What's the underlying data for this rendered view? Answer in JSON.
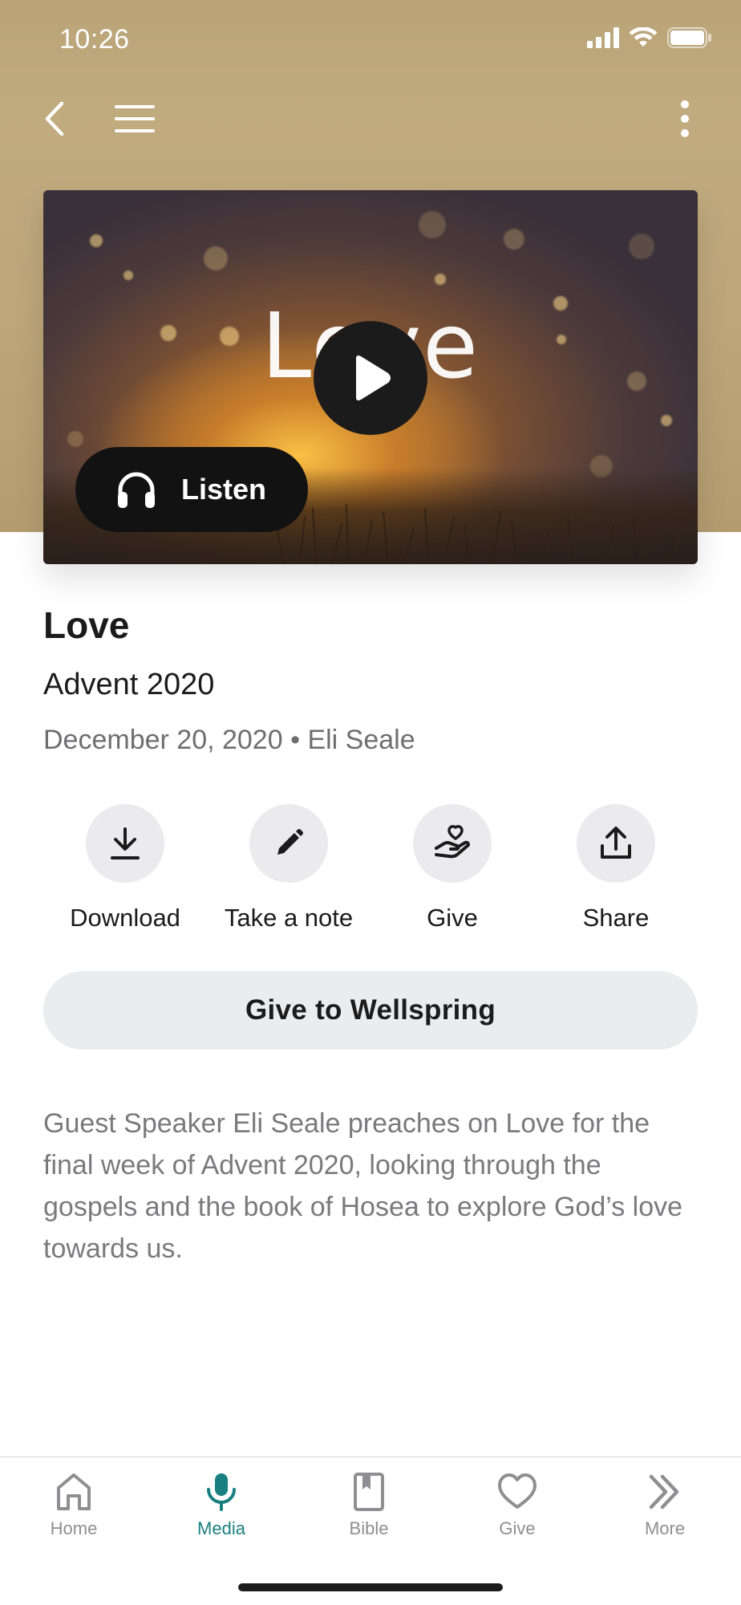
{
  "status_bar": {
    "time": "10:26"
  },
  "nav": {
    "back_icon": "chevron-left-icon",
    "menu_icon": "hamburger-icon",
    "more_icon": "vertical-dots-icon"
  },
  "media": {
    "card_title": "Love",
    "play_icon": "play-icon",
    "listen_label": "Listen",
    "listen_icon": "headphones-icon"
  },
  "sermon": {
    "title": "Love",
    "series": "Advent 2020",
    "date": "December 20, 2020",
    "separator": "•",
    "speaker": "Eli Seale"
  },
  "actions": [
    {
      "label": "Download",
      "icon": "download-icon"
    },
    {
      "label": "Take a note",
      "icon": "pencil-icon"
    },
    {
      "label": "Give",
      "icon": "heart-hand-icon"
    },
    {
      "label": "Share",
      "icon": "share-icon"
    }
  ],
  "give_cta": "Give to Wellspring",
  "description": "Guest Speaker Eli Seale preaches on Love for the final week of Advent 2020, looking through the gospels and the book of Hosea to explore God’s love towards us.",
  "tabs": [
    {
      "label": "Home",
      "icon": "home-icon",
      "active": false
    },
    {
      "label": "Media",
      "icon": "microphone-icon",
      "active": true
    },
    {
      "label": "Bible",
      "icon": "book-icon",
      "active": false
    },
    {
      "label": "Give",
      "icon": "heart-icon",
      "active": false
    },
    {
      "label": "More",
      "icon": "double-chevron-icon",
      "active": false
    }
  ],
  "colors": {
    "header_bg": "#bda679",
    "accent": "#1a7f80",
    "inactive_tab": "#8e8e93",
    "button_bg": "#ebecee"
  }
}
